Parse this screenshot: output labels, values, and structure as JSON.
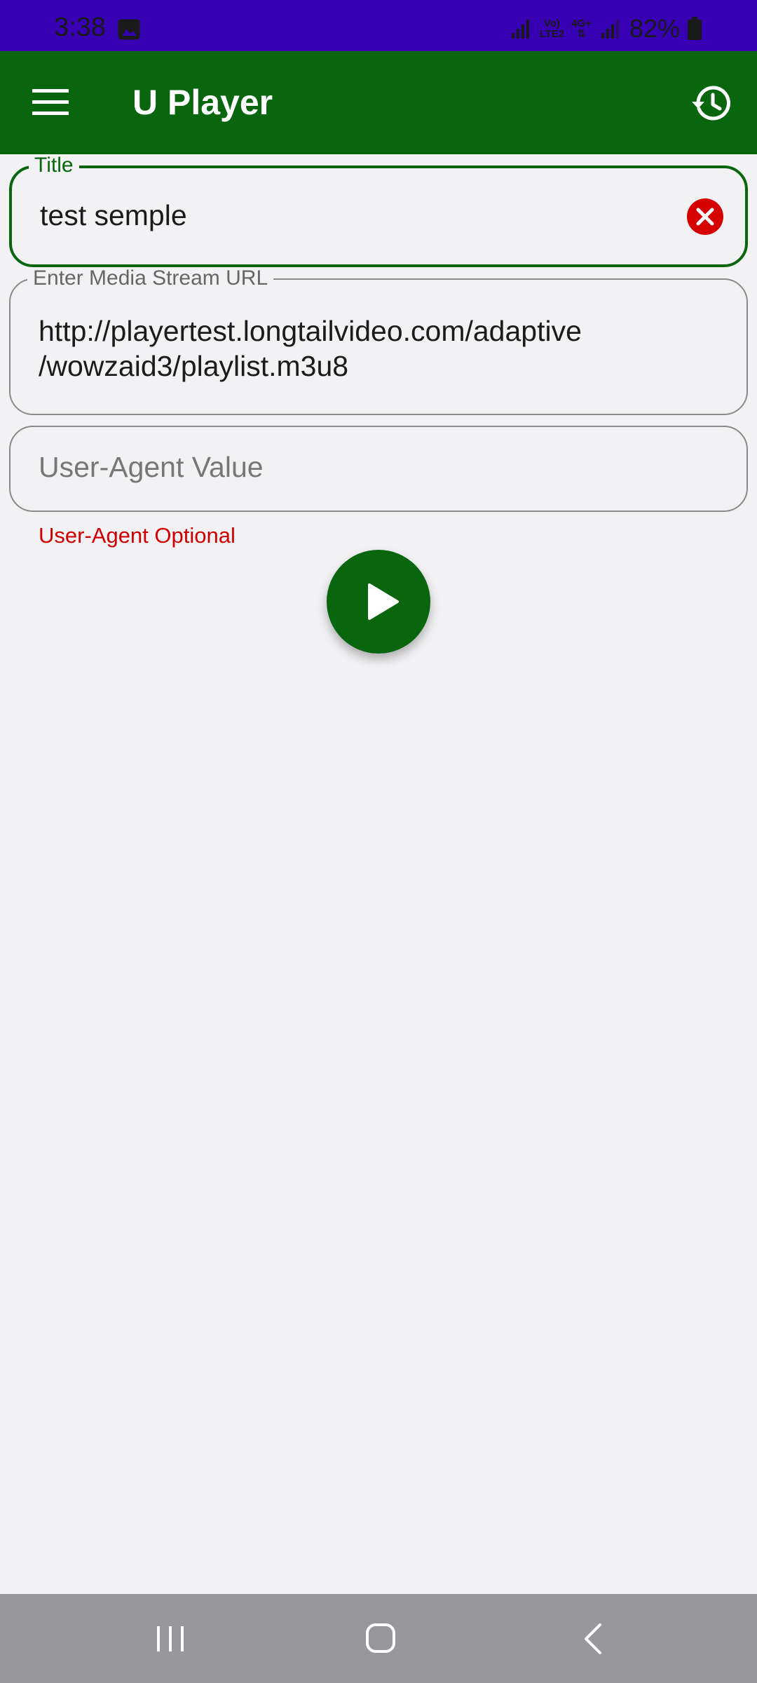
{
  "status_bar": {
    "time": "3:38",
    "network_label_top": "Vo)",
    "network_label_bottom": "LTE2",
    "network_type": "4G+",
    "battery": "82%",
    "gallery_icon": "image-icon",
    "colors": {
      "background": "#3700b3"
    }
  },
  "app_bar": {
    "title": "U Player",
    "menu_icon": "hamburger-menu-icon",
    "history_icon": "history-icon",
    "colors": {
      "background": "#0a650f",
      "title": "#ffffff"
    }
  },
  "form": {
    "title_field": {
      "label": "Title",
      "value": "test semple",
      "clear_icon": "clear-icon"
    },
    "url_field": {
      "label": "Enter Media Stream URL",
      "value": "http://playertest.longtailvideo.com/adaptive\n/wowzaid3/playlist.m3u8"
    },
    "user_agent_field": {
      "placeholder": "User-Agent Value",
      "value": ""
    },
    "helper_text": "User-Agent Optional",
    "play_button_icon": "play-icon",
    "colors": {
      "accent": "#0a650f",
      "error": "#d00000",
      "clear_icon": "#d50000"
    }
  },
  "nav_bar": {
    "recent_icon": "recent-apps-icon",
    "home_icon": "home-icon",
    "back_icon": "back-icon"
  }
}
